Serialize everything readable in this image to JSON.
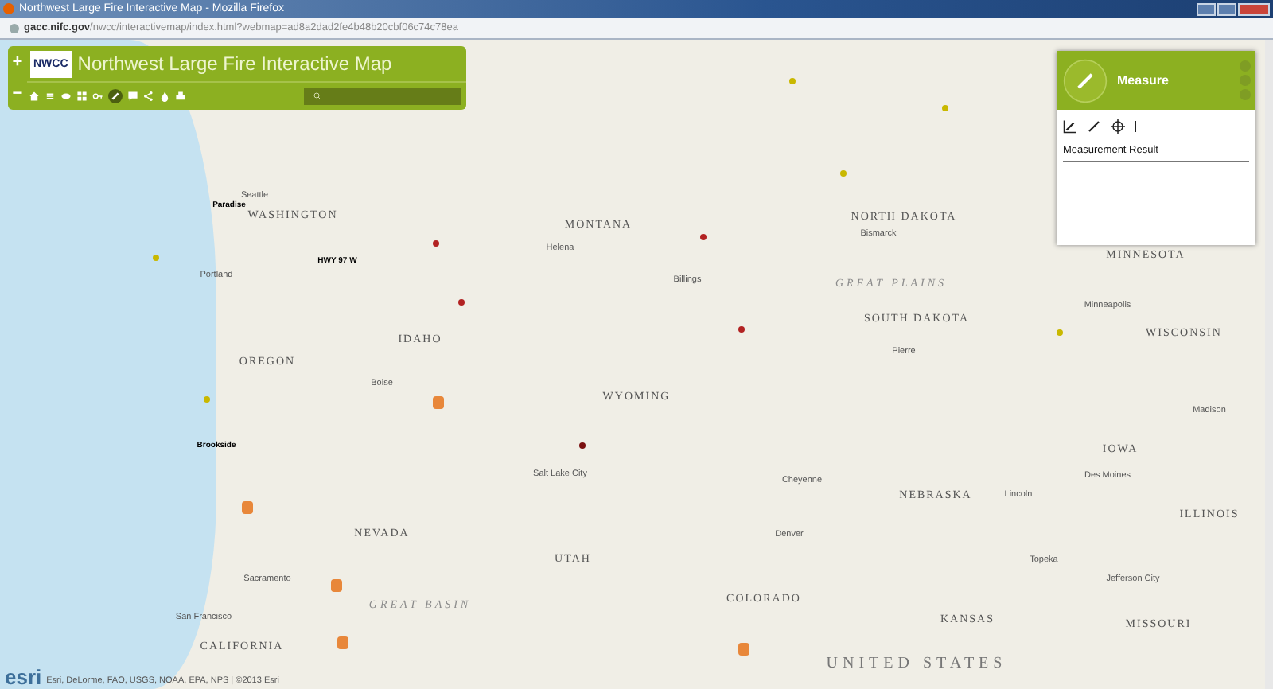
{
  "window": {
    "title": "Northwest Large Fire Interactive Map - Mozilla Firefox"
  },
  "address_bar": {
    "url_host": "gacc.nifc.gov",
    "url_path": "/nwcc/interactivemap/index.html?webmap=ad8a2dad2fe4b48b20cbf06c74c78ea"
  },
  "app_header": {
    "logo": "NWCC",
    "title": "Northwest Large Fire Interactive Map",
    "zoom_in": "+",
    "zoom_out": "−"
  },
  "measure_panel": {
    "title": "Measure",
    "result_label": "Measurement Result"
  },
  "map_labels": [
    {
      "text": "Seattle",
      "kind": "city"
    },
    {
      "text": "Paradise",
      "kind": "fire"
    },
    {
      "text": "WASHINGTON",
      "kind": "state"
    },
    {
      "text": "NORTH DAKOTA",
      "kind": "state"
    },
    {
      "text": "MONTANA",
      "kind": "state"
    },
    {
      "text": "Bismarck",
      "kind": "city"
    },
    {
      "text": "Helena",
      "kind": "city"
    },
    {
      "text": "MINNESOTA",
      "kind": "state"
    },
    {
      "text": "HWY 97 W",
      "kind": "fire"
    },
    {
      "text": "Portland",
      "kind": "city"
    },
    {
      "text": "Billings",
      "kind": "city"
    },
    {
      "text": "GREAT PLAINS",
      "kind": "region"
    },
    {
      "text": "Minneapolis",
      "kind": "city"
    },
    {
      "text": "SOUTH DAKOTA",
      "kind": "state"
    },
    {
      "text": "WISCONSIN",
      "kind": "state"
    },
    {
      "text": "IDAHO",
      "kind": "state"
    },
    {
      "text": "Pierre",
      "kind": "city"
    },
    {
      "text": "OREGON",
      "kind": "state"
    },
    {
      "text": "Boise",
      "kind": "city"
    },
    {
      "text": "WYOMING",
      "kind": "state"
    },
    {
      "text": "Madison",
      "kind": "city"
    },
    {
      "text": "Brookside",
      "kind": "fire"
    },
    {
      "text": "IOWA",
      "kind": "state"
    },
    {
      "text": "Salt Lake City",
      "kind": "city"
    },
    {
      "text": "Des Moines",
      "kind": "city"
    },
    {
      "text": "Cheyenne",
      "kind": "city"
    },
    {
      "text": "NEBRASKA",
      "kind": "state"
    },
    {
      "text": "Lincoln",
      "kind": "city"
    },
    {
      "text": "ILLINOIS",
      "kind": "state"
    },
    {
      "text": "NEVADA",
      "kind": "state"
    },
    {
      "text": "Denver",
      "kind": "city"
    },
    {
      "text": "UTAH",
      "kind": "state"
    },
    {
      "text": "Topeka",
      "kind": "city"
    },
    {
      "text": "Sacramento",
      "kind": "city"
    },
    {
      "text": "Jefferson City",
      "kind": "city"
    },
    {
      "text": "COLORADO",
      "kind": "state"
    },
    {
      "text": "GREAT BASIN",
      "kind": "region"
    },
    {
      "text": "San Francisco",
      "kind": "city"
    },
    {
      "text": "KANSAS",
      "kind": "state"
    },
    {
      "text": "MISSOURI",
      "kind": "state"
    },
    {
      "text": "CALIFORNIA",
      "kind": "state"
    },
    {
      "text": "UNITED STATES",
      "kind": "country"
    }
  ],
  "fire_markers": [
    {
      "color": "#c9b800"
    },
    {
      "color": "#c9b800"
    },
    {
      "color": "#c9b800"
    },
    {
      "color": "#b22222"
    },
    {
      "color": "#b22222"
    },
    {
      "color": "#c9b800"
    },
    {
      "color": "#b22222"
    },
    {
      "color": "#b22222"
    },
    {
      "color": "#c9b800"
    },
    {
      "color": "#c9b800"
    },
    {
      "color": "#7a1010"
    }
  ],
  "attribution": {
    "logo": "esri",
    "text": "Esri, DeLorme, FAO, USGS, NOAA, EPA, NPS | ©2013 Esri"
  }
}
